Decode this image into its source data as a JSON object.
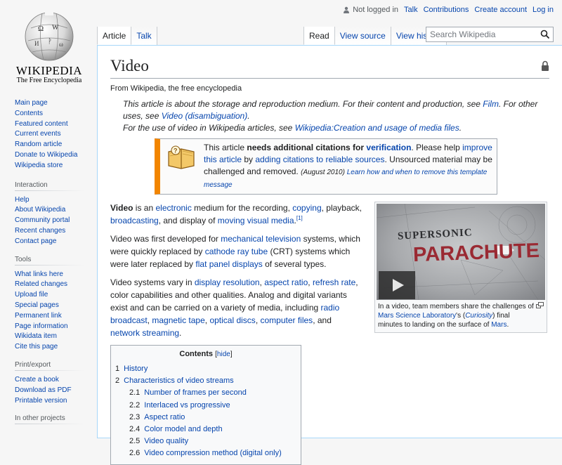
{
  "logo": {
    "wordmark": "WIKIPEDIA",
    "tagline": "The Free Encyclopedia"
  },
  "personal": {
    "status": "Not logged in",
    "links": [
      "Talk",
      "Contributions",
      "Create account",
      "Log in"
    ]
  },
  "tabs": {
    "left": [
      {
        "label": "Article",
        "selected": true
      },
      {
        "label": "Talk",
        "selected": false
      }
    ],
    "right": [
      {
        "label": "Read",
        "selected": true
      },
      {
        "label": "View source",
        "selected": false
      },
      {
        "label": "View history",
        "selected": false
      }
    ]
  },
  "search": {
    "placeholder": "Search Wikipedia"
  },
  "sidebar": {
    "main": [
      "Main page",
      "Contents",
      "Featured content",
      "Current events",
      "Random article",
      "Donate to Wikipedia",
      "Wikipedia store"
    ],
    "interaction": {
      "heading": "Interaction",
      "items": [
        "Help",
        "About Wikipedia",
        "Community portal",
        "Recent changes",
        "Contact page"
      ]
    },
    "tools": {
      "heading": "Tools",
      "items": [
        "What links here",
        "Related changes",
        "Upload file",
        "Special pages",
        "Permanent link",
        "Page information",
        "Wikidata item",
        "Cite this page"
      ]
    },
    "print": {
      "heading": "Print/export",
      "items": [
        "Create a book",
        "Download as PDF",
        "Printable version"
      ]
    },
    "other": {
      "heading": "In other projects"
    }
  },
  "article": {
    "title": "Video",
    "site_sub": "From Wikipedia, the free encyclopedia",
    "hatnote1": {
      "t1": "This article is about the storage and reproduction medium. For their content and production, see ",
      "l1": "Film",
      "t2": ". For other uses, see ",
      "l2": "Video (disambiguation)",
      "t3": "."
    },
    "hatnote2": {
      "t1": "For the use of video in Wikipedia articles, see ",
      "l1": "Wikipedia:Creation and usage of media files",
      "t2": "."
    },
    "ambox": {
      "t1": "This article ",
      "b1": "needs additional citations for ",
      "l1": "verification",
      "t2": ". Please help ",
      "l2": "improve this article",
      "t3": " by ",
      "l3": "adding citations to reliable sources",
      "t4": ". Unsourced material may be challenged and removed.",
      "date": "(August 2010)",
      "l4": "Learn how and when to remove this template message"
    },
    "p1": {
      "b1": "Video",
      "t1": " is an ",
      "l1": "electronic",
      "t2": " medium for the recording, ",
      "l2": "copying",
      "t3": ", playback, ",
      "l3": "broadcasting",
      "t4": ", and display of ",
      "l4": "moving visual media",
      "t5": ".",
      "ref": "[1]"
    },
    "p2": {
      "t1": "Video was first developed for ",
      "l1": "mechanical television",
      "t2": " systems, which were quickly replaced by ",
      "l2": "cathode ray tube",
      "t3": " (CRT) systems which were later replaced by ",
      "l3": "flat panel displays",
      "t4": " of several types."
    },
    "p3": {
      "t1": "Video systems vary in ",
      "l1": "display resolution",
      "t2": ", ",
      "l2": "aspect ratio",
      "t3": ", ",
      "l3": "refresh rate",
      "t4": ", color capabilities and other qualities. Analog and digital variants exist and can be carried on a variety of media, including ",
      "l4": "radio broadcast",
      "t5": ", ",
      "l5": "magnetic tape",
      "t6": ", ",
      "l6": "optical discs",
      "t7": ", ",
      "l7": "computer files",
      "t8": ", and ",
      "l8": "network streaming",
      "t9": "."
    },
    "thumb": {
      "image_title_top": "SUPERSONIC",
      "image_title_main": "PARACHUTE",
      "caption": {
        "t1": "In a video, team members share the challenges of ",
        "l1": "Mars Science Laboratory",
        "t2": "'s (",
        "l2": "Curiosity",
        "t3": ") final minutes to landing on the surface of ",
        "l3": "Mars",
        "t4": "."
      }
    },
    "toc": {
      "title": "Contents",
      "hide": "hide",
      "items": [
        {
          "num": "1",
          "label": "History",
          "level": 1
        },
        {
          "num": "2",
          "label": "Characteristics of video streams",
          "level": 1
        },
        {
          "num": "2.1",
          "label": "Number of frames per second",
          "level": 2
        },
        {
          "num": "2.2",
          "label": "Interlaced vs progressive",
          "level": 2
        },
        {
          "num": "2.3",
          "label": "Aspect ratio",
          "level": 2
        },
        {
          "num": "2.4",
          "label": "Color model and depth",
          "level": 2
        },
        {
          "num": "2.5",
          "label": "Video quality",
          "level": 2
        },
        {
          "num": "2.6",
          "label": "Video compression method (digital only)",
          "level": 2
        }
      ]
    }
  }
}
